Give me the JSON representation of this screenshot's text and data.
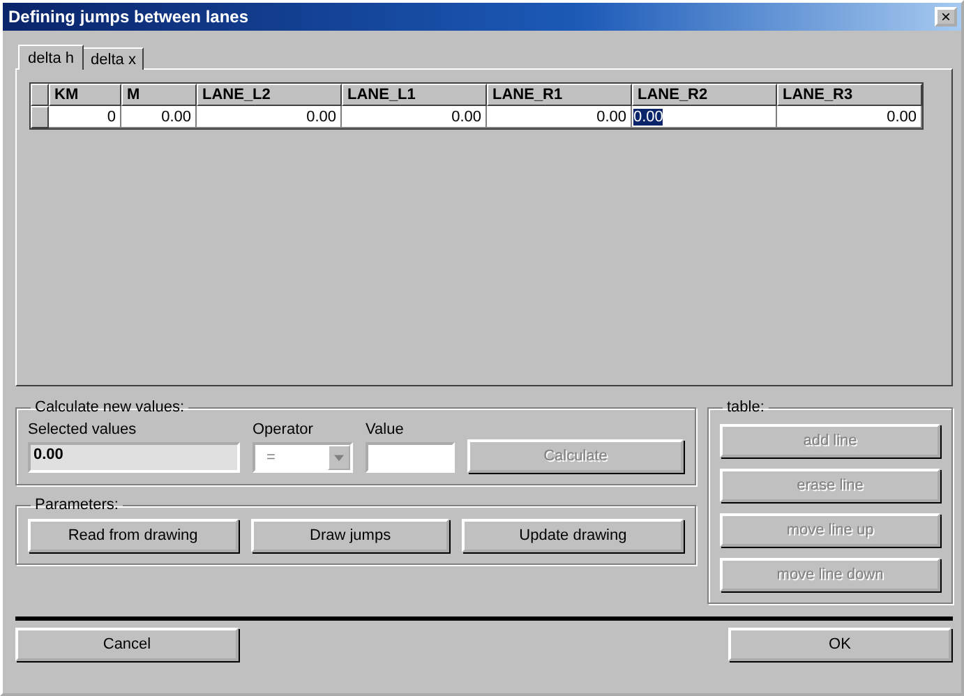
{
  "window": {
    "title": "Defining jumps between lanes",
    "close": "×"
  },
  "tabs": [
    {
      "label": "delta h",
      "selected": true
    },
    {
      "label": "delta x",
      "selected": false
    }
  ],
  "table": {
    "columns": [
      "KM",
      "M",
      "LANE_L2",
      "LANE_L1",
      "LANE_R1",
      "LANE_R2",
      "LANE_R3"
    ],
    "rows": [
      {
        "cells": [
          {
            "text": "0",
            "selected": false
          },
          {
            "text": "0.00",
            "selected": false
          },
          {
            "text": "0.00",
            "selected": false
          },
          {
            "text": "0.00",
            "selected": false
          },
          {
            "text": "0.00",
            "selected": false
          },
          {
            "text": "0.00",
            "selected": true
          },
          {
            "text": "0.00",
            "selected": false
          }
        ]
      }
    ]
  },
  "calculate": {
    "title": "Calculate new values:",
    "selected_label": "Selected values",
    "selected_value": "0.00",
    "operator_label": "Operator",
    "operator": "=",
    "value_label": "Value",
    "button": {
      "label": "Calculate",
      "disabled": true
    }
  },
  "parameters": {
    "title": "Parameters:",
    "buttons": [
      {
        "label": "Read from drawing",
        "disabled": false
      },
      {
        "label": "Draw jumps",
        "disabled": false
      },
      {
        "label": "Update drawing",
        "disabled": false
      }
    ]
  },
  "table_actions": {
    "title": "table:",
    "buttons": [
      {
        "label": "add line",
        "disabled": true
      },
      {
        "label": "erase line",
        "disabled": true
      },
      {
        "label": "move line up",
        "disabled": true
      },
      {
        "label": "move line down",
        "disabled": true
      }
    ]
  },
  "footer": {
    "cancel": "Cancel",
    "ok": "OK"
  }
}
